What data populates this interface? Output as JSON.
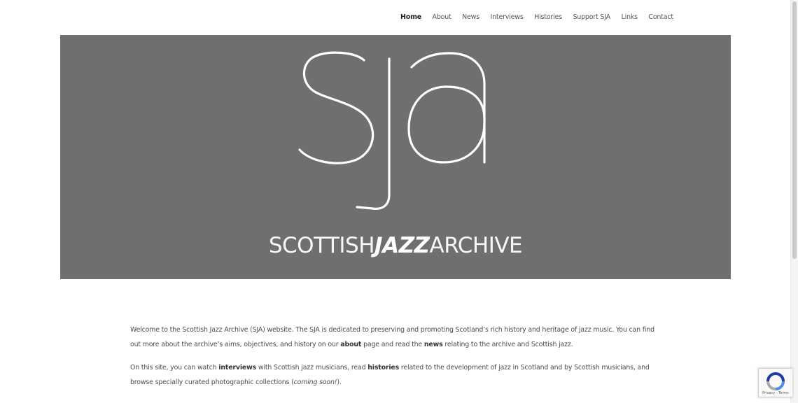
{
  "nav": {
    "items": [
      {
        "label": "Home",
        "active": true
      },
      {
        "label": "About"
      },
      {
        "label": "News"
      },
      {
        "label": "Interviews"
      },
      {
        "label": "Histories"
      },
      {
        "label": "Support SJA"
      },
      {
        "label": "Links"
      },
      {
        "label": "Contact"
      }
    ]
  },
  "hero": {
    "logo_letters": "sja",
    "wordmark": {
      "part1": "SCOTTISH",
      "part2": "JAZZ",
      "part3": "ARCHIVE"
    },
    "background": "#6f6f6f"
  },
  "content": {
    "p1": {
      "a": "Welcome to the Scottish Jazz Archive (SJA) website. The SJA is dedicated to preserving and promoting Scotland’s rich history and heritage of jazz music. You can find out more about the archive’s aims, objectives, and history on our ",
      "b": "about",
      "c": " page and read the ",
      "d": "news",
      "e": " relating to the archive and Scottish jazz."
    },
    "p2": {
      "a": "On this site, you can watch ",
      "b": "interviews",
      "c": " with Scottish jazz musicians, read ",
      "d": "histories",
      "e": " related to the development of jazz in Scotland and by Scottish musicians, and browse specially curated photographic collections (",
      "f": "coming soon!",
      "g": ")."
    }
  },
  "recaptcha": {
    "label": "Privacy - Terms",
    "icon": "recaptcha-icon"
  }
}
